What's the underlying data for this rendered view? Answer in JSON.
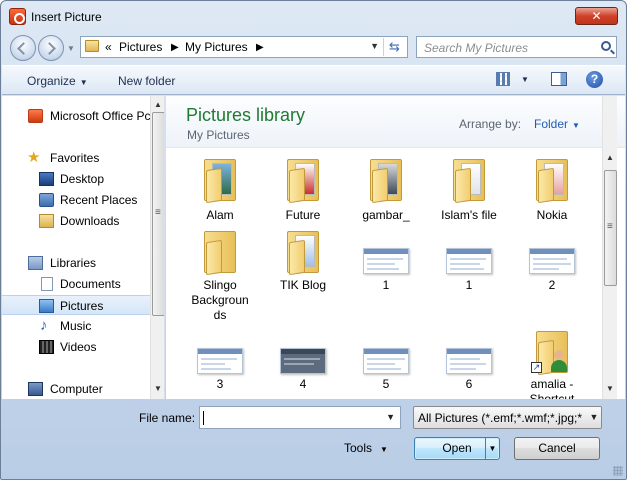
{
  "window": {
    "title": "Insert Picture",
    "close_glyph": "✕"
  },
  "address": {
    "prefix": "«",
    "crumbs": [
      "Pictures",
      "My Pictures"
    ],
    "separator": "▶",
    "dropdown_glyph": "▼",
    "refresh_glyph": "⇆"
  },
  "search": {
    "placeholder": "Search My Pictures"
  },
  "toolbar": {
    "organize": "Organize",
    "new_folder": "New folder",
    "help": "?",
    "caret": "▼"
  },
  "nav": {
    "items": [
      {
        "label": "Microsoft Office Pc",
        "icon": "office-icon"
      },
      {
        "label": "Favorites",
        "icon": "star-icon"
      },
      {
        "label": "Desktop",
        "icon": "desktop-icon"
      },
      {
        "label": "Recent Places",
        "icon": "recent-places-icon"
      },
      {
        "label": "Downloads",
        "icon": "downloads-icon"
      },
      {
        "label": "Libraries",
        "icon": "libraries-icon"
      },
      {
        "label": "Documents",
        "icon": "documents-icon"
      },
      {
        "label": "Pictures",
        "icon": "pictures-icon",
        "selected": true
      },
      {
        "label": "Music",
        "icon": "music-icon"
      },
      {
        "label": "Videos",
        "icon": "videos-icon"
      },
      {
        "label": "Computer",
        "icon": "computer-icon"
      }
    ]
  },
  "content": {
    "title": "Pictures library",
    "subtitle": "My Pictures",
    "arrange_label": "Arrange by:",
    "arrange_value": "Folder",
    "items": [
      {
        "name": "Alam",
        "kind": "folder"
      },
      {
        "name": "Future",
        "kind": "folder"
      },
      {
        "name": "gambar_",
        "kind": "folder"
      },
      {
        "name": "Islam's file",
        "kind": "folder"
      },
      {
        "name": "Nokia",
        "kind": "folder"
      },
      {
        "name": "Slingo\nBackgroun\nds",
        "kind": "folder"
      },
      {
        "name": "TIK Blog",
        "kind": "folder"
      },
      {
        "name": "1",
        "kind": "image"
      },
      {
        "name": "1",
        "kind": "image"
      },
      {
        "name": "2",
        "kind": "image"
      },
      {
        "name": "3",
        "kind": "image"
      },
      {
        "name": "4",
        "kind": "image"
      },
      {
        "name": "5",
        "kind": "image"
      },
      {
        "name": "6",
        "kind": "image"
      },
      {
        "name": "amalia -\nShortcut",
        "kind": "shortcut"
      }
    ]
  },
  "footer": {
    "file_name_label": "File name:",
    "file_name_value": "",
    "file_type": "All Pictures (*.emf;*.wmf;*.jpg;*",
    "tools": "Tools",
    "open": "Open",
    "cancel": "Cancel"
  },
  "colors": {
    "library_title": "#1f7a33",
    "link_blue": "#1f5bb8",
    "selection": "#d5e6f8"
  }
}
